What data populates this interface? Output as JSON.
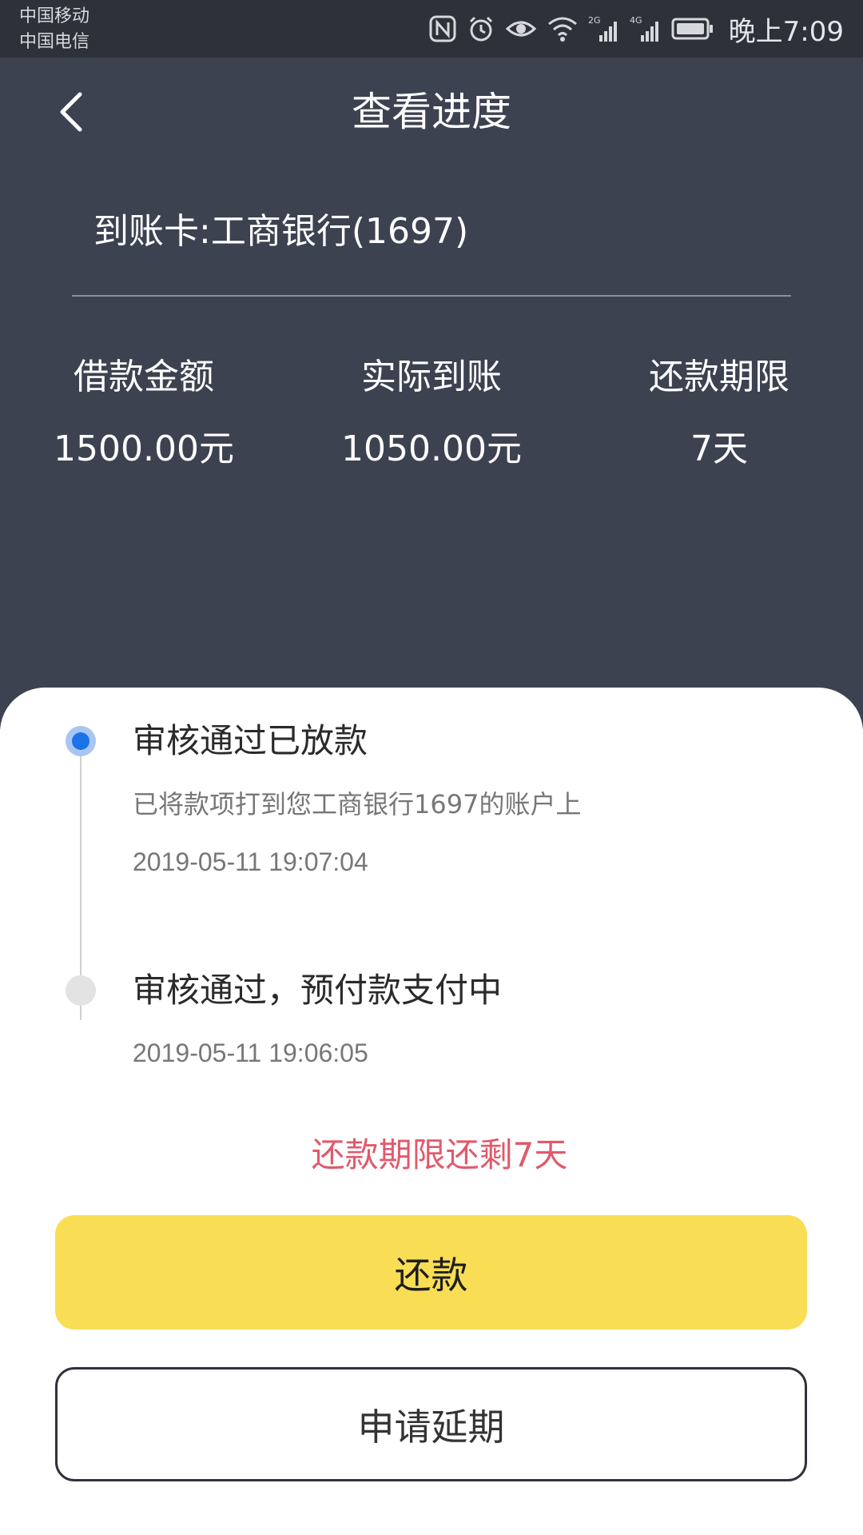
{
  "status_bar": {
    "carrier1": "中国移动",
    "carrier2": "中国电信",
    "icons": [
      "nfc-icon",
      "alarm-icon",
      "eye-icon",
      "wifi-icon",
      "signal-2g-icon",
      "signal-4g-icon",
      "battery-icon"
    ],
    "signal_2g_label": "2G",
    "signal_4g_label": "4G",
    "time": "晚上7:09"
  },
  "header": {
    "back_icon": "chevron-left-icon",
    "title": "查看进度",
    "card_label": "到账卡:工商银行(1697)",
    "stats": [
      {
        "label": "借款金额",
        "value": "1500.00元"
      },
      {
        "label": "实际到账",
        "value": "1050.00元"
      },
      {
        "label": "还款期限",
        "value": "7天"
      }
    ]
  },
  "timeline": {
    "steps": [
      {
        "title": "审核通过已放款",
        "desc": "已将款项打到您工商银行1697的账户上",
        "time": "2019-05-11 19:07:04",
        "active": true
      },
      {
        "title": "审核通过，预付款支付中",
        "time": "2019-05-11 19:06:05",
        "active": false
      }
    ]
  },
  "remaining_text": "还款期限还剩7天",
  "buttons": {
    "repay_label": "还款",
    "extend_label": "申请延期"
  },
  "colors": {
    "header_bg": "#3d4250",
    "status_bar_bg": "#2d3139",
    "accent_blue": "#1a73e8",
    "warning_red": "#e05a6c",
    "repay_yellow": "#f9dd55"
  }
}
